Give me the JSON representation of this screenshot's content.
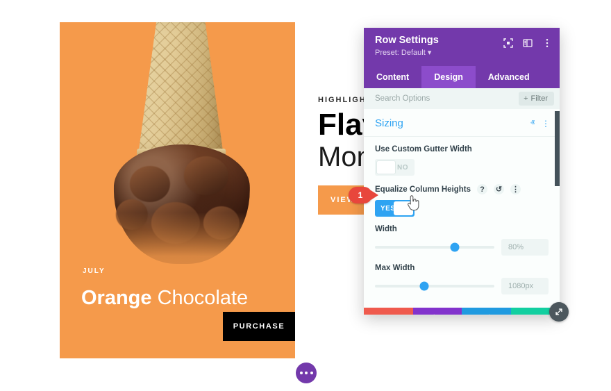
{
  "promo_card": {
    "month": "JULY",
    "title_bold": "Orange",
    "title_light": "Chocolate",
    "purchase_label": "PURCHASE",
    "background_color": "#f59a4b",
    "button_color": "#000000"
  },
  "text_column": {
    "eyebrow": "HIGHLIGHT",
    "headline": "Flav",
    "subheadline": "Mon",
    "cta_label": "VIEW A",
    "cta_color": "#f59a4b"
  },
  "step_badge": {
    "number": "1",
    "color": "#e8463c"
  },
  "settings_panel": {
    "title": "Row Settings",
    "preset": "Preset: Default",
    "preset_caret": "▾",
    "header_color": "#7339ab",
    "header_icons": [
      {
        "name": "focus-target-icon"
      },
      {
        "name": "layout-panel-icon"
      },
      {
        "name": "more-vertical-icon"
      }
    ],
    "tabs": [
      {
        "label": "Content",
        "active": false
      },
      {
        "label": "Design",
        "active": true
      },
      {
        "label": "Advanced",
        "active": false
      }
    ],
    "search": {
      "placeholder": "Search Options",
      "value": "",
      "filter_label": "Filter",
      "filter_plus": "+"
    },
    "section": {
      "title": "Sizing",
      "title_color": "#2ea3f2",
      "collapse_icon": "ⱏ",
      "more_icon": "⋮"
    },
    "fields": [
      {
        "label": "Use Custom Gutter Width",
        "type": "toggle",
        "state": "NO",
        "on": false,
        "icons": []
      },
      {
        "label": "Equalize Column Heights",
        "type": "toggle",
        "state": "YES",
        "on": true,
        "icons": [
          "?",
          "↺",
          "⋮"
        ]
      },
      {
        "label": "Width",
        "type": "slider",
        "value": "80%",
        "knob_percent": 67
      },
      {
        "label": "Max Width",
        "type": "slider",
        "value": "1080px",
        "knob_percent": 41
      }
    ],
    "footer": [
      {
        "name": "cancel",
        "icon": "close-x-icon",
        "color": "#ef5a4d"
      },
      {
        "name": "undo",
        "icon": "undo-arrow-icon",
        "color": "#8233cc"
      },
      {
        "name": "redo",
        "icon": "redo-arrow-icon",
        "color": "#1f9ae0"
      },
      {
        "name": "save",
        "icon": "checkmark-icon",
        "color": "#12cfa0"
      }
    ]
  },
  "floating_button": {
    "name": "page-settings-dots",
    "color": "#7339ab"
  },
  "resize_handle": {
    "name": "resize-diagonal-icon",
    "color": "#4c575d"
  }
}
